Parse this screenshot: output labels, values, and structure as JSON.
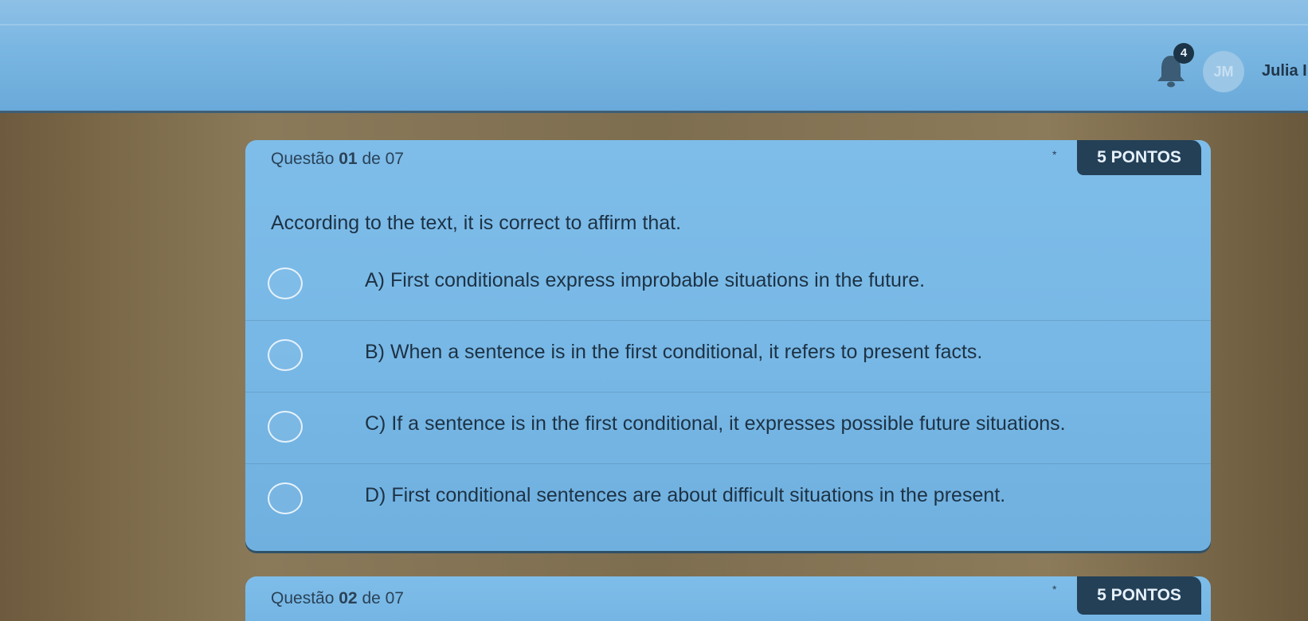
{
  "header": {
    "notification_count": "4",
    "avatar_initials": "JM",
    "user_name": "Julia I"
  },
  "questions": [
    {
      "label_prefix": "Questão",
      "number": "01",
      "label_suffix": "de 07",
      "required_marker": "*",
      "points": "5 PONTOS",
      "prompt": "According to the text, it is correct to affirm that.",
      "options": [
        "A) First conditionals express improbable situations in the future.",
        "B) When a sentence is in the first conditional, it refers to present facts.",
        "C) If a sentence is in the first conditional, it expresses possible future situations.",
        "D) First conditional sentences are about difficult situations in the present."
      ]
    },
    {
      "label_prefix": "Questão",
      "number": "02",
      "label_suffix": "de 07",
      "required_marker": "*",
      "points": "5 PONTOS"
    }
  ]
}
